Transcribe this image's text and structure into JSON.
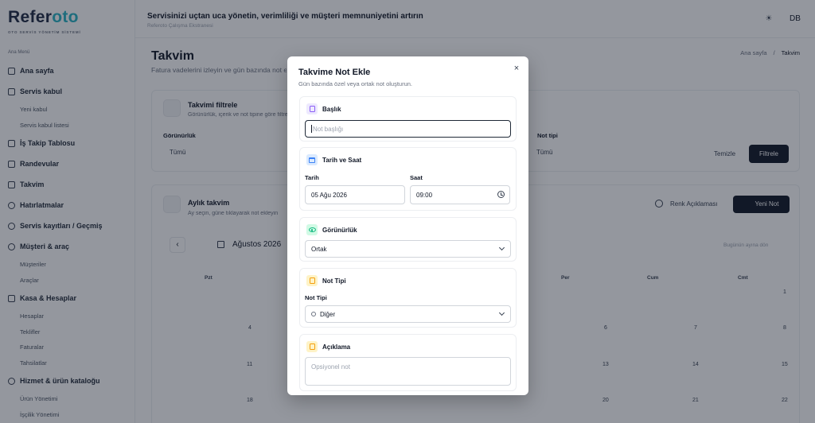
{
  "brand": {
    "name_start": "Refer",
    "name_accent": "oto",
    "subtitle": "OTO SERVİS YÖNETİM SİSTEMİ"
  },
  "sidebar": {
    "menu_title": "Ana Menü",
    "items": [
      {
        "type": "main",
        "label": "Ana sayfa"
      },
      {
        "type": "main",
        "label": "Servis kabul"
      },
      {
        "type": "sub",
        "label": "Yeni kabul"
      },
      {
        "type": "sub",
        "label": "Servis kabul listesi"
      },
      {
        "type": "main",
        "label": "İş Takip Tablosu"
      },
      {
        "type": "main",
        "label": "Randevular"
      },
      {
        "type": "main",
        "label": "Takvim"
      },
      {
        "type": "main",
        "label": "Hatırlatmalar"
      },
      {
        "type": "main",
        "label": "Servis kayıtları / Geçmiş"
      },
      {
        "type": "main",
        "label": "Müşteri & araç"
      },
      {
        "type": "sub",
        "label": "Müşteriler"
      },
      {
        "type": "sub",
        "label": "Araçlar"
      },
      {
        "type": "main",
        "label": "Kasa & Hesaplar"
      },
      {
        "type": "sub",
        "label": "Hesaplar"
      },
      {
        "type": "sub",
        "label": "Teklifler"
      },
      {
        "type": "sub",
        "label": "Faturalar"
      },
      {
        "type": "sub",
        "label": "Tahsilatlar"
      },
      {
        "type": "main",
        "label": "Hizmet & ürün kataloğu"
      },
      {
        "type": "sub",
        "label": "Ürün Yönetimi"
      },
      {
        "type": "sub",
        "label": "İşçilik Yönetimi"
      }
    ]
  },
  "header": {
    "tagline": "Servisinizi uçtan uca yönetin, verimliliği ve müşteri memnuniyetini artırın",
    "workspace": "Referoto Çalışma Ekstranesi",
    "theme_icon": "☀",
    "avatar": "DB"
  },
  "page": {
    "title": "Takvim",
    "description": "Fatura vadelerini izleyin ve gün bazında not ekleyin",
    "breadcrumb": [
      "Ana sayfa",
      "Takvim"
    ]
  },
  "filter_card": {
    "title": "Takvimi filtrele",
    "description": "Görünürlük, içerik ve not tipine göre filtreleyin",
    "visibility_label": "Görünürlük",
    "visibility_value": "Tümü",
    "type_label": "Not tipi",
    "type_value": "Tümü",
    "clear_label": "Temizle",
    "apply_label": "Filtrele"
  },
  "calendar_card": {
    "title": "Aylık takvim",
    "description": "Ay seçin, güne tıklayarak not ekleyin",
    "legend_label": "Renk Açıklaması",
    "new_note_label": "Yeni Not",
    "month": "Ağustos 2026",
    "go_today": "Bugünün ayına dön",
    "weekdays": [
      "Pzt",
      "Per",
      "Cum",
      "Cmt"
    ],
    "row_numbers": [
      [
        "1"
      ],
      [
        "4",
        "6",
        "7",
        "8"
      ],
      [
        "11",
        "13",
        "14",
        "15"
      ],
      [
        "18",
        "20",
        "21",
        "22"
      ]
    ]
  },
  "modal": {
    "title": "Takvime Not Ekle",
    "subtitle": "Gün bazında özel veya ortak not oluşturun.",
    "close_glyph": "×",
    "title_section": {
      "heading": "Başlık",
      "placeholder": "Not başlığı"
    },
    "datetime_section": {
      "heading": "Tarih ve Saat",
      "date_label": "Tarih",
      "date_value": "05 Ağu 2026",
      "time_label": "Saat",
      "time_value": "09:00"
    },
    "visibility_section": {
      "heading": "Görünürlük",
      "value": "Ortak"
    },
    "type_section": {
      "heading": "Not Tipi",
      "label": "Not Tipi",
      "value": "Diğer"
    },
    "description_section": {
      "heading": "Açıklama",
      "placeholder": "Opsiyonel not"
    }
  },
  "colors": {
    "accent": "#2bb3c4",
    "title_icon": "#8b5cf6",
    "datetime_icon": "#3b82f6",
    "visibility_icon": "#10b981",
    "type_icon": "#f59e0b",
    "description_icon": "#f59e0b"
  }
}
